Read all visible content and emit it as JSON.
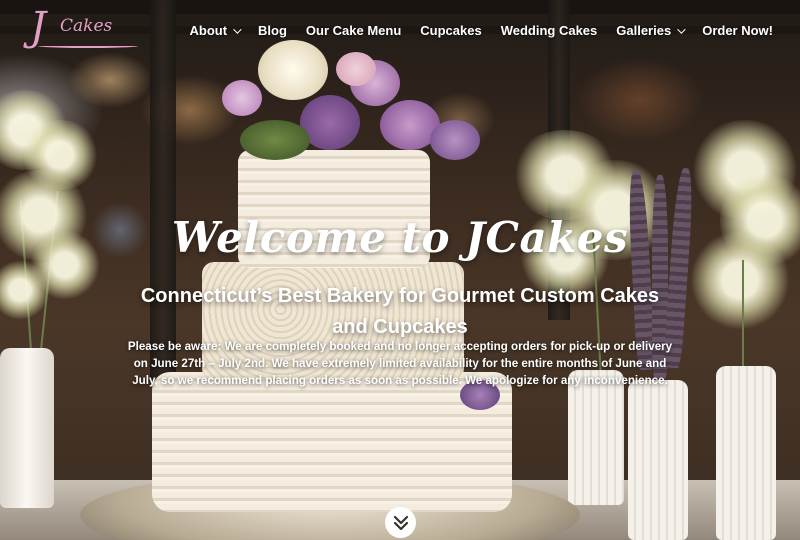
{
  "brand": {
    "logo_initial": "J",
    "logo_text": "Cakes",
    "logo_color": "#e2a0c6"
  },
  "nav": {
    "items": [
      {
        "label": "About",
        "has_dropdown": true
      },
      {
        "label": "Blog",
        "has_dropdown": false
      },
      {
        "label": "Our Cake Menu",
        "has_dropdown": false
      },
      {
        "label": "Cupcakes",
        "has_dropdown": false
      },
      {
        "label": "Wedding Cakes",
        "has_dropdown": false
      },
      {
        "label": "Galleries",
        "has_dropdown": true
      },
      {
        "label": "Order Now!",
        "has_dropdown": false
      }
    ]
  },
  "hero": {
    "welcome": "Welcome to JCakes",
    "subtitle": "Connecticut’s Best Bakery for Gourmet Custom Cakes and Cupcakes",
    "notice": "Please be aware: We are completely booked and no longer accepting orders for pick-up or delivery on June 27th – July 2nd. We have extremely limited availability for the entire months of June and July, so we recommend placing orders as soon as possible. We apologize for any inconvenience.",
    "scroll_icon": "double-chevron-down-icon"
  }
}
